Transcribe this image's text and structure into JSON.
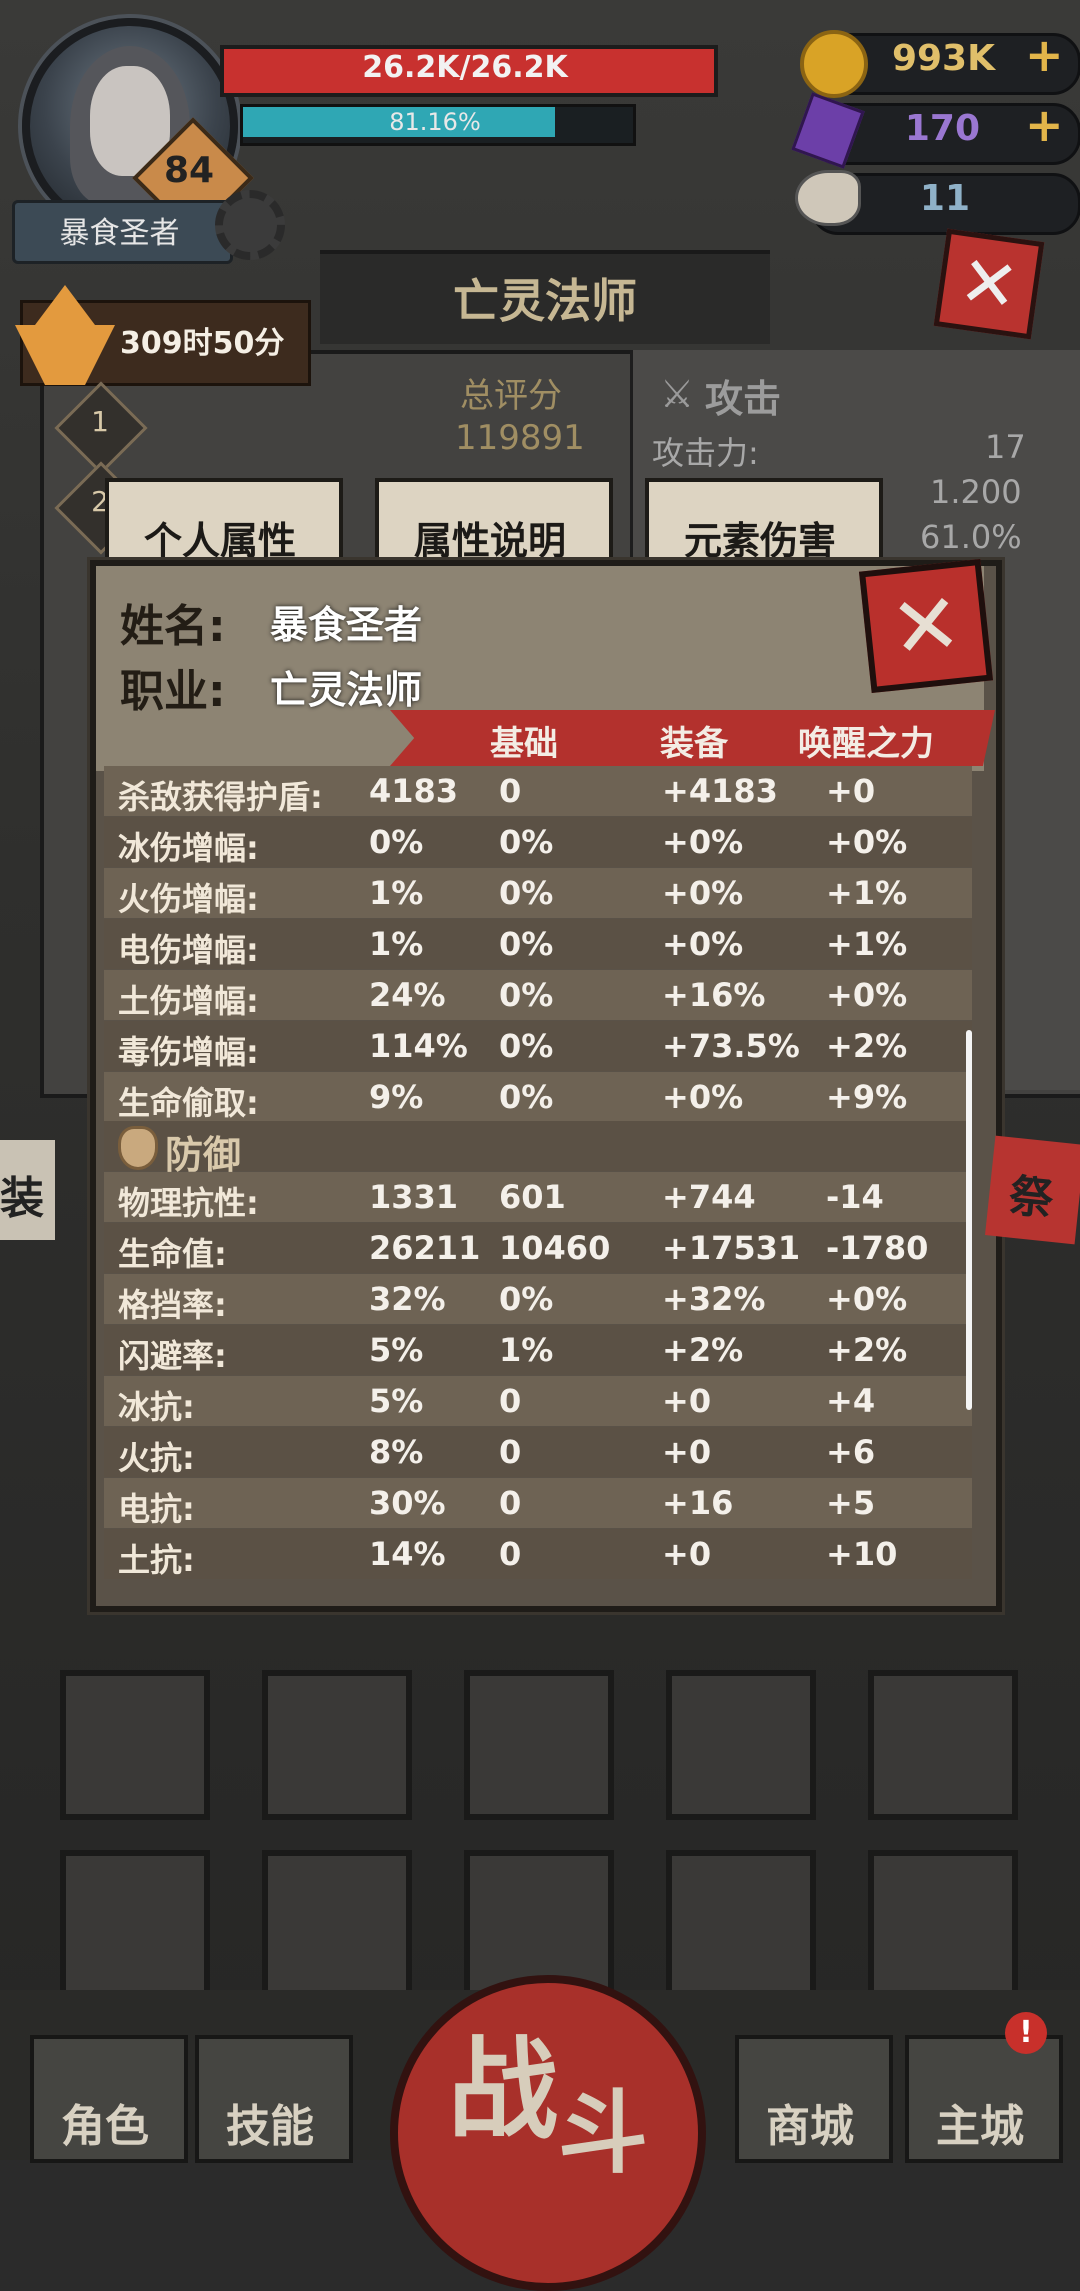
{
  "player": {
    "name": "暴食圣者",
    "level": "84",
    "hp_text": "26.2K/26.2K",
    "exp_text": "81.16%",
    "exp_progress": 0.8116
  },
  "currency": {
    "gold": "993K",
    "gems": "170",
    "ram_tokens": "11",
    "plus": "+"
  },
  "class_title": "亡灵法师",
  "timer": {
    "text": "309时50分"
  },
  "ranks": [
    "1",
    "2"
  ],
  "score": {
    "label": "总评分",
    "value": "119891"
  },
  "attack_panel": {
    "title": "攻击",
    "rows": [
      {
        "label": "攻击力:",
        "value": "17"
      },
      {
        "value": "1.200"
      },
      {
        "value": "61.0%"
      }
    ]
  },
  "tabs": [
    "个人属性",
    "属性说明",
    "元素伤害"
  ],
  "modal": {
    "name_label": "姓名:",
    "name_value": "暴食圣者",
    "class_label": "职业:",
    "class_value": "亡灵法师",
    "columns": [
      "基础",
      "装备",
      "唤醒之力"
    ],
    "rows_a": [
      {
        "name": "杀敌获得护盾:",
        "total": "4183",
        "base": "0",
        "equip": "+4183",
        "awake": "+0"
      },
      {
        "name": "冰伤增幅:",
        "total": "0%",
        "base": "0%",
        "equip": "+0%",
        "awake": "+0%"
      },
      {
        "name": "火伤增幅:",
        "total": "1%",
        "base": "0%",
        "equip": "+0%",
        "awake": "+1%"
      },
      {
        "name": "电伤增幅:",
        "total": "1%",
        "base": "0%",
        "equip": "+0%",
        "awake": "+1%"
      },
      {
        "name": "土伤增幅:",
        "total": "24%",
        "base": "0%",
        "equip": "+16%",
        "awake": "+0%"
      },
      {
        "name": "毒伤增幅:",
        "total": "114%",
        "base": "0%",
        "equip": "+73.5%",
        "awake": "+2%"
      },
      {
        "name": "生命偷取:",
        "total": "9%",
        "base": "0%",
        "equip": "+0%",
        "awake": "+9%"
      }
    ],
    "defense_title": "防御",
    "rows_b": [
      {
        "name": "物理抗性:",
        "total": "1331",
        "base": "601",
        "equip": "+744",
        "awake": "-14"
      },
      {
        "name": "生命值:",
        "total": "26211",
        "base": "10460",
        "equip": "+17531",
        "awake": "-1780"
      },
      {
        "name": "格挡率:",
        "total": "32%",
        "base": "0%",
        "equip": "+32%",
        "awake": "+0%"
      },
      {
        "name": "闪避率:",
        "total": "5%",
        "base": "1%",
        "equip": "+2%",
        "awake": "+2%"
      },
      {
        "name": "冰抗:",
        "total": "5%",
        "base": "0",
        "equip": "+0",
        "awake": "+4"
      },
      {
        "name": "火抗:",
        "total": "8%",
        "base": "0",
        "equip": "+0",
        "awake": "+6"
      },
      {
        "name": "电抗:",
        "total": "30%",
        "base": "0",
        "equip": "+16",
        "awake": "+5"
      },
      {
        "name": "土抗:",
        "total": "14%",
        "base": "0",
        "equip": "+0",
        "awake": "+10"
      }
    ]
  },
  "side": {
    "left_char": "装",
    "right_char": "祭"
  },
  "nav": {
    "character": "角色",
    "skills": "技能",
    "battle_1": "战",
    "battle_2": "斗",
    "shop": "商城",
    "main_city": "主城",
    "notif": "!"
  },
  "colors": {
    "hp": "#c8312f",
    "exp": "#2fa7b4",
    "accent_red": "#b3312d",
    "gold": "#e2b54a"
  }
}
